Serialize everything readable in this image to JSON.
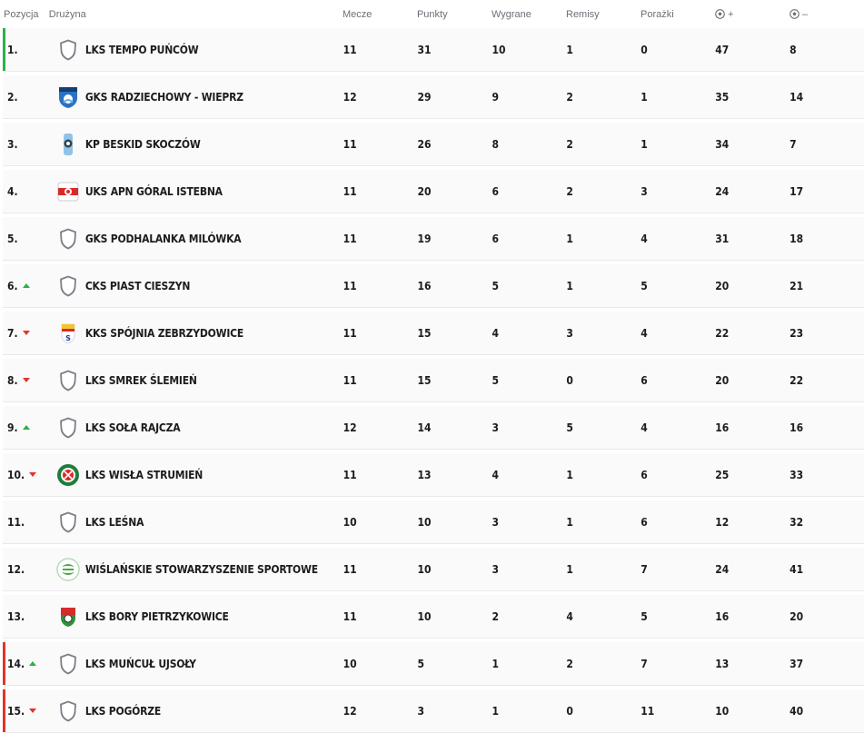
{
  "header": {
    "position": "Pozycja",
    "team": "Drużyna",
    "matches": "Mecze",
    "points": "Punkty",
    "wins": "Wygrane",
    "draws": "Remisy",
    "losses": "Porażki",
    "goals_for": "+",
    "goals_against": "–"
  },
  "colors": {
    "promotion": "#2bb04a",
    "relegation": "#e2342b",
    "up": "#2bb04a",
    "down": "#e2342b"
  },
  "rows": [
    {
      "pos": "1.",
      "trend": "",
      "zone": "promotion",
      "logo": "shield-outline-icon",
      "team": "LKS TEMPO PUŃCÓW",
      "m": "11",
      "p": "31",
      "w": "10",
      "d": "1",
      "l": "0",
      "gf": "47",
      "ga": "8"
    },
    {
      "pos": "2.",
      "trend": "",
      "zone": "",
      "logo": "gks-radziechowy-crest-icon",
      "team": "GKS RADZIECHOWY - WIEPRZ",
      "m": "12",
      "p": "29",
      "w": "9",
      "d": "2",
      "l": "1",
      "gf": "35",
      "ga": "14"
    },
    {
      "pos": "3.",
      "trend": "",
      "zone": "",
      "logo": "kp-beskid-crest-icon",
      "team": "KP BESKID SKOCZÓW",
      "m": "11",
      "p": "26",
      "w": "8",
      "d": "2",
      "l": "1",
      "gf": "34",
      "ga": "7"
    },
    {
      "pos": "4.",
      "trend": "",
      "zone": "",
      "logo": "uks-apn-crest-icon",
      "team": "UKS APN GÓRAL ISTEBNA",
      "m": "11",
      "p": "20",
      "w": "6",
      "d": "2",
      "l": "3",
      "gf": "24",
      "ga": "17"
    },
    {
      "pos": "5.",
      "trend": "",
      "zone": "",
      "logo": "shield-outline-icon",
      "team": "GKS PODHALANKA MILÓWKA",
      "m": "11",
      "p": "19",
      "w": "6",
      "d": "1",
      "l": "4",
      "gf": "31",
      "ga": "18"
    },
    {
      "pos": "6.",
      "trend": "up",
      "zone": "",
      "logo": "shield-outline-icon",
      "team": "CKS PIAST CIESZYN",
      "m": "11",
      "p": "16",
      "w": "5",
      "d": "1",
      "l": "5",
      "gf": "20",
      "ga": "21"
    },
    {
      "pos": "7.",
      "trend": "down",
      "zone": "",
      "logo": "kks-spojnia-crest-icon",
      "team": "KKS SPÓJNIA ZEBRZYDOWICE",
      "m": "11",
      "p": "15",
      "w": "4",
      "d": "3",
      "l": "4",
      "gf": "22",
      "ga": "23"
    },
    {
      "pos": "8.",
      "trend": "down",
      "zone": "",
      "logo": "shield-outline-icon",
      "team": "LKS SMREK ŚLEMIEŃ",
      "m": "11",
      "p": "15",
      "w": "5",
      "d": "0",
      "l": "6",
      "gf": "20",
      "ga": "22"
    },
    {
      "pos": "9.",
      "trend": "up",
      "zone": "",
      "logo": "shield-outline-icon",
      "team": "LKS SOŁA RAJCZA",
      "m": "12",
      "p": "14",
      "w": "3",
      "d": "5",
      "l": "4",
      "gf": "16",
      "ga": "16"
    },
    {
      "pos": "10.",
      "trend": "down",
      "zone": "",
      "logo": "lks-wisla-crest-icon",
      "team": "LKS WISŁA STRUMIEŃ",
      "m": "11",
      "p": "13",
      "w": "4",
      "d": "1",
      "l": "6",
      "gf": "25",
      "ga": "33"
    },
    {
      "pos": "11.",
      "trend": "",
      "zone": "",
      "logo": "shield-outline-icon",
      "team": "LKS LEŚNA",
      "m": "10",
      "p": "10",
      "w": "3",
      "d": "1",
      "l": "6",
      "gf": "12",
      "ga": "32"
    },
    {
      "pos": "12.",
      "trend": "",
      "zone": "",
      "logo": "wss-crest-icon",
      "team": "WIŚLAŃSKIE STOWARZYSZENIE SPORTOWE",
      "m": "11",
      "p": "10",
      "w": "3",
      "d": "1",
      "l": "7",
      "gf": "24",
      "ga": "41"
    },
    {
      "pos": "13.",
      "trend": "",
      "zone": "",
      "logo": "lks-bory-crest-icon",
      "team": "LKS BORY PIETRZYKOWICE",
      "m": "11",
      "p": "10",
      "w": "2",
      "d": "4",
      "l": "5",
      "gf": "16",
      "ga": "20"
    },
    {
      "pos": "14.",
      "trend": "up",
      "zone": "relegation",
      "logo": "shield-outline-icon",
      "team": "LKS MUŃCUŁ UJSOŁY",
      "m": "10",
      "p": "5",
      "w": "1",
      "d": "2",
      "l": "7",
      "gf": "13",
      "ga": "37"
    },
    {
      "pos": "15.",
      "trend": "down",
      "zone": "relegation",
      "logo": "shield-outline-icon",
      "team": "LKS POGÓRZE",
      "m": "12",
      "p": "3",
      "w": "1",
      "d": "0",
      "l": "11",
      "gf": "10",
      "ga": "40"
    }
  ]
}
